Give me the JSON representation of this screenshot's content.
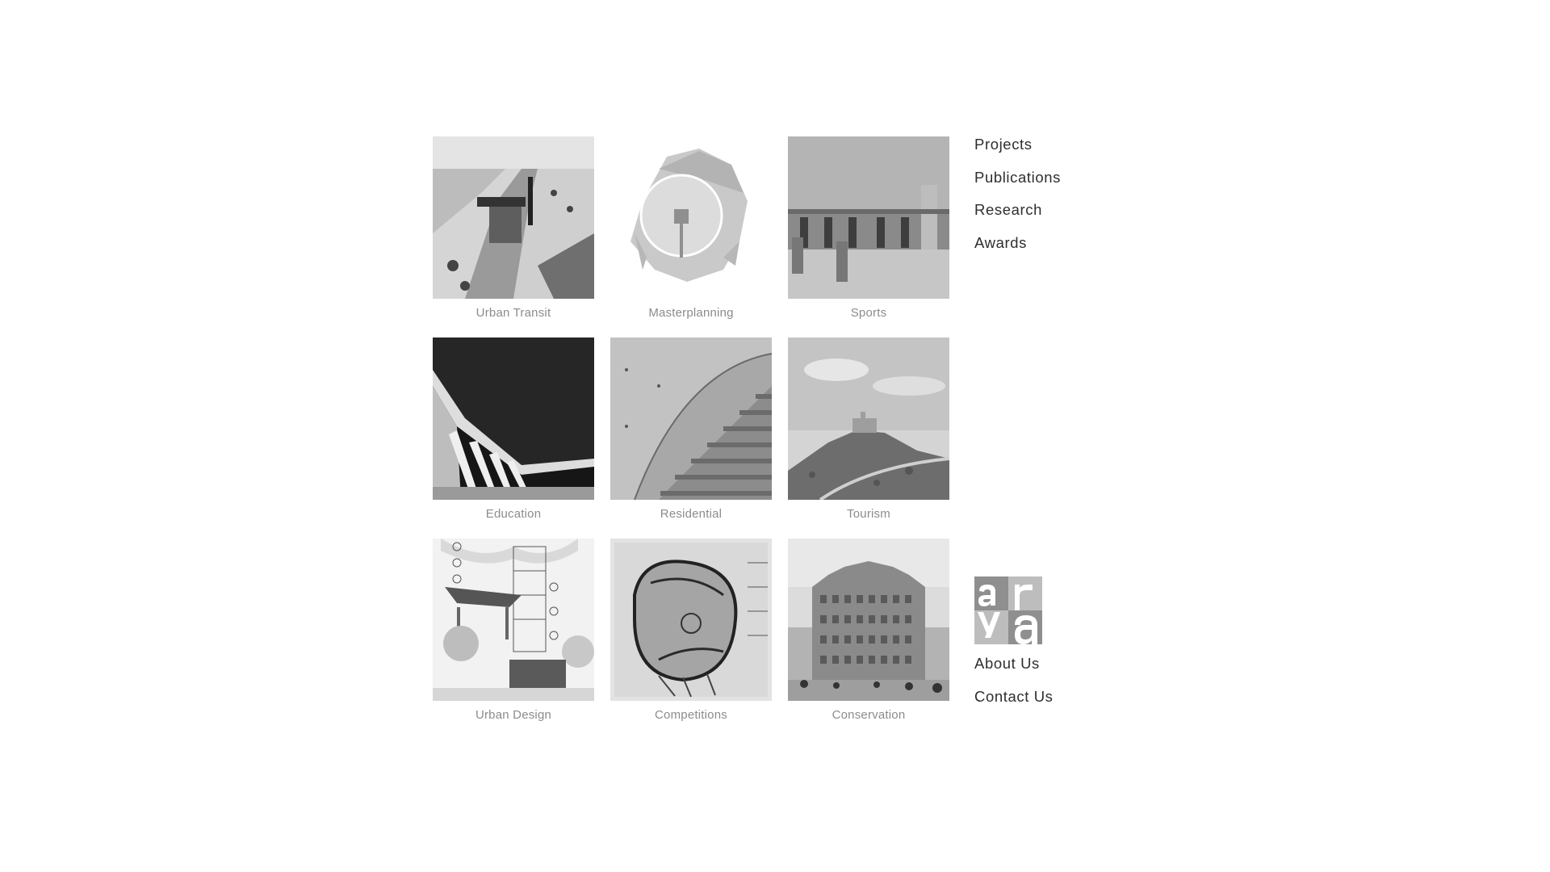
{
  "categories": [
    {
      "label": "Urban Transit",
      "icon": "urban-transit-photo"
    },
    {
      "label": "Masterplanning",
      "icon": "masterplan-diagram"
    },
    {
      "label": "Sports",
      "icon": "sports-building-photo"
    },
    {
      "label": "Education",
      "icon": "education-canopy-photo"
    },
    {
      "label": "Residential",
      "icon": "concrete-stairs-photo"
    },
    {
      "label": "Tourism",
      "icon": "hill-fort-photo"
    },
    {
      "label": "Urban Design",
      "icon": "urban-design-collage"
    },
    {
      "label": "Competitions",
      "icon": "competition-sketch"
    },
    {
      "label": "Conservation",
      "icon": "heritage-facade-photo"
    }
  ],
  "nav": {
    "top": [
      "Projects",
      "Publications",
      "Research",
      "Awards"
    ],
    "bottom": [
      "About Us",
      "Contact Us"
    ]
  },
  "logo": {
    "letters": [
      "a",
      "r",
      "y",
      "a"
    ],
    "colors": {
      "dark": "#8f8f8f",
      "light": "#bdbdbd"
    }
  },
  "colors": {
    "caption": "#8c8c8c",
    "nav_text": "#2e2e2e",
    "background": "#ffffff"
  }
}
